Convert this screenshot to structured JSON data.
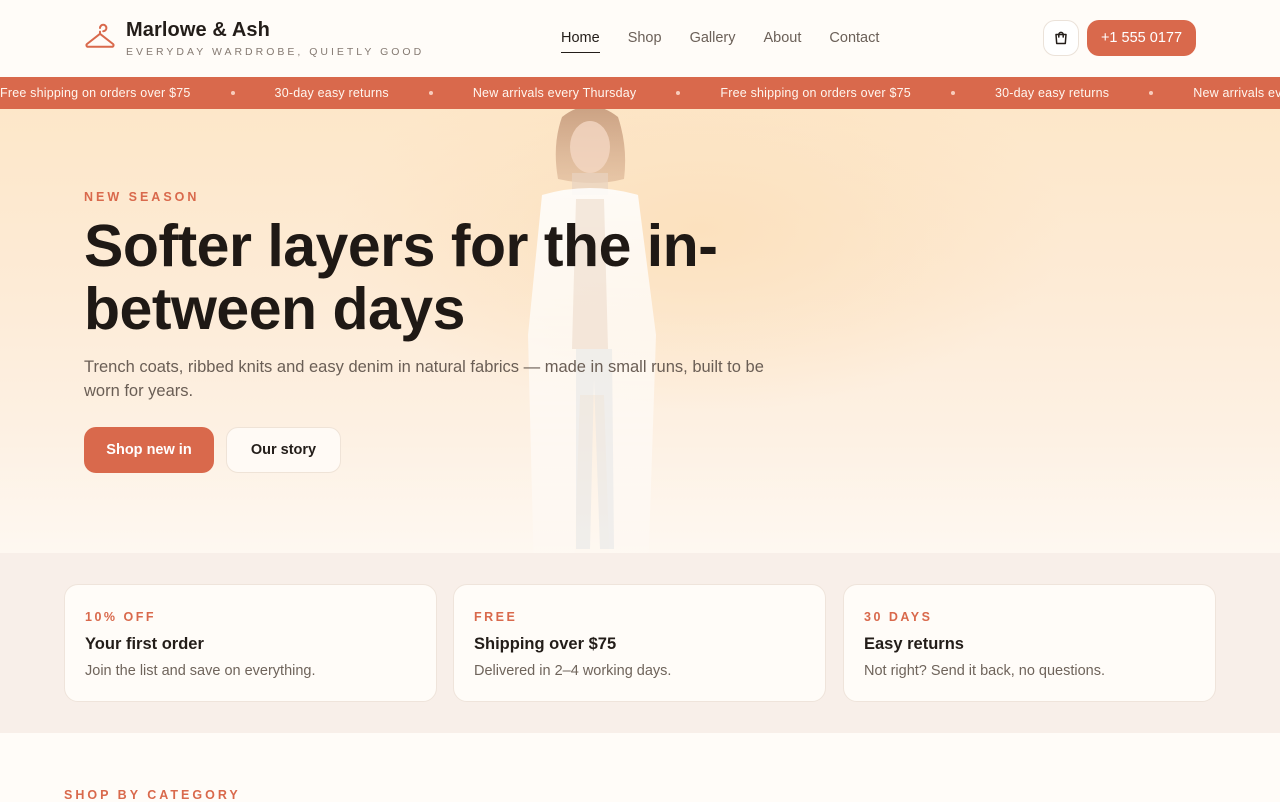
{
  "brand": {
    "name": "Marlowe & Ash",
    "tagline": "EVERYDAY WARDROBE, QUIETLY GOOD"
  },
  "nav": {
    "items": [
      {
        "label": "Home",
        "active": true
      },
      {
        "label": "Shop"
      },
      {
        "label": "Gallery"
      },
      {
        "label": "About"
      },
      {
        "label": "Contact"
      }
    ]
  },
  "header": {
    "cart_icon": "shopping-bag-icon",
    "phone_label": "+1 555 0177"
  },
  "ticker": {
    "items": [
      "Free shipping on orders over $75",
      "30-day easy returns",
      "New arrivals every Thursday",
      "Free shipping on orders over $75",
      "30-day easy returns",
      "New arrivals every Thursday"
    ]
  },
  "hero": {
    "eyebrow": "NEW SEASON",
    "title": "Softer layers for the in-between days",
    "subtitle": "Trench coats, ribbed knits and easy denim in natural fabrics — made in small runs, built to be worn for years.",
    "primary_cta": "Shop new in",
    "secondary_cta": "Our story"
  },
  "perks": [
    {
      "tag": "10% OFF",
      "title": "Your first order",
      "desc": "Join the list and save on everything."
    },
    {
      "tag": "FREE",
      "title": "Shipping over $75",
      "desc": "Delivered in 2–4 working days."
    },
    {
      "tag": "30 DAYS",
      "title": "Easy returns",
      "desc": "Not right? Send it back, no questions."
    }
  ],
  "categories": {
    "label": "SHOP BY CATEGORY"
  },
  "colors": {
    "accent": "#d9694c",
    "ink": "#231d19",
    "muted": "#6a5e55",
    "cream": "#fffcf8",
    "perk_band": "#f8efe9"
  }
}
